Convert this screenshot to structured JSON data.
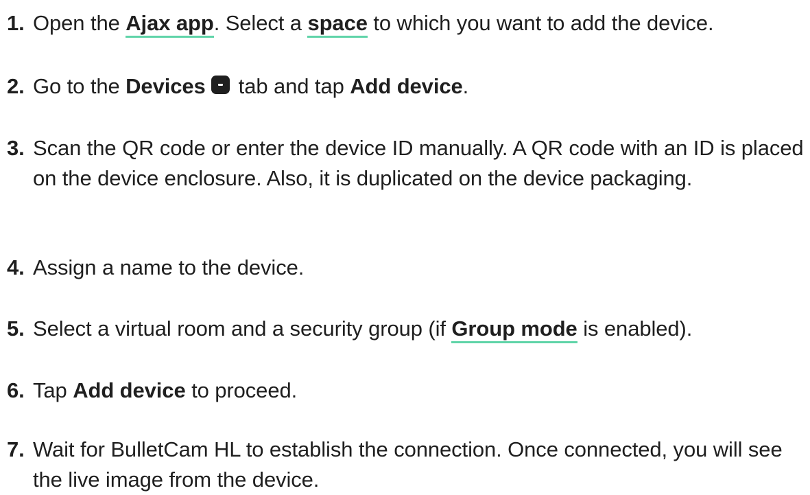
{
  "steps": [
    {
      "number": "1.",
      "t1": "Open the ",
      "link1": "Ajax app",
      "t2": ". Select a ",
      "link2": "space",
      "t3": " to which you want to add the device."
    },
    {
      "number": "2.",
      "t1": "Go to the ",
      "b1": "Devices",
      "icon": "devices-tab-icon",
      "t2": " tab and tap ",
      "b2": "Add device",
      "t3": "."
    },
    {
      "number": "3.",
      "text": "Scan the QR code or enter the device ID manually. A QR code with an ID is placed on the device enclosure. Also, it is duplicated on the device packaging."
    },
    {
      "number": "4.",
      "text": "Assign a name to the device."
    },
    {
      "number": "5.",
      "t1": "Select a virtual room and a security group (if ",
      "link1": "Group mode",
      "t2": " is enabled)."
    },
    {
      "number": "6.",
      "t1": "Tap ",
      "b1": "Add device",
      "t2": " to proceed."
    },
    {
      "number": "7.",
      "text": "Wait for BulletCam HL to establish the connection. Once connected, you will see the live image from the device."
    }
  ],
  "colors": {
    "text": "#1f1f1f",
    "link_underline": "#5fd4a8",
    "background": "#ffffff"
  }
}
